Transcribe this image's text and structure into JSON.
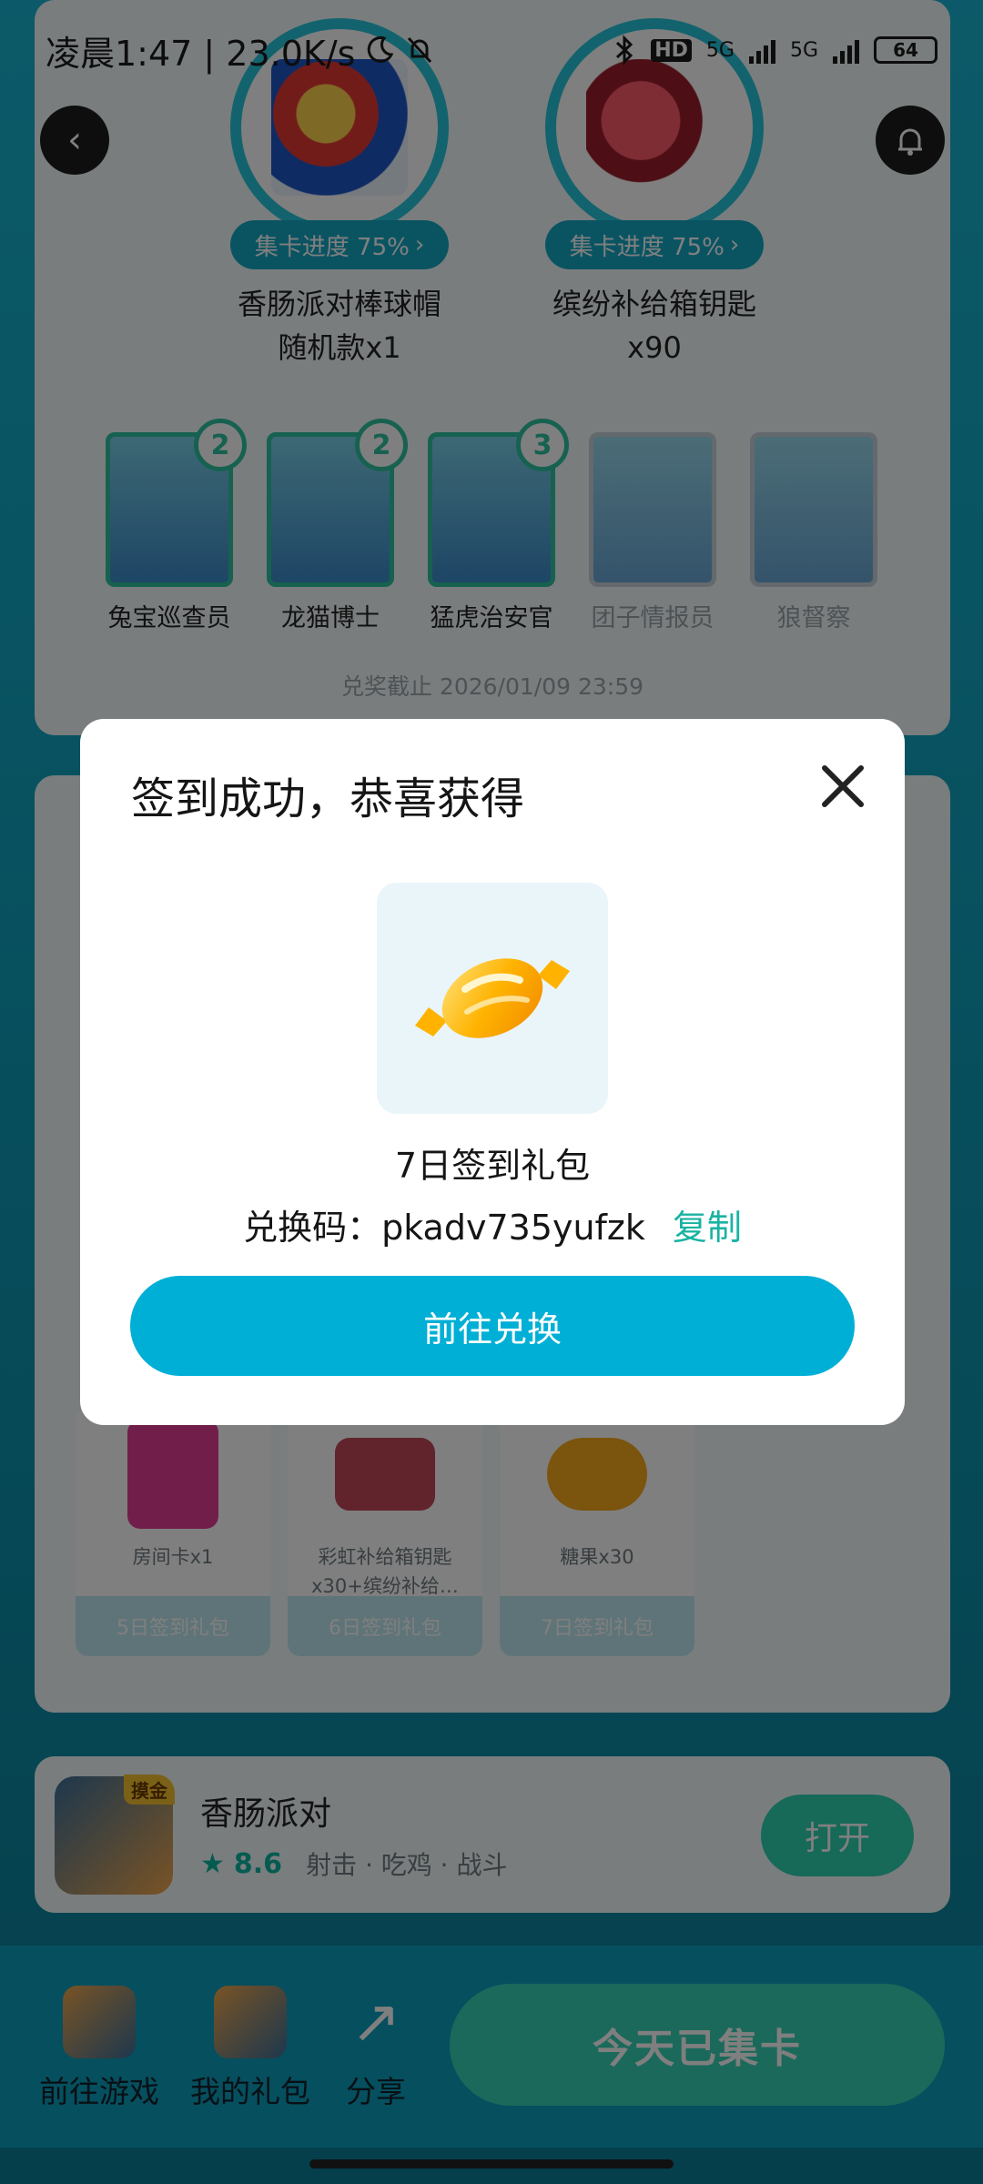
{
  "status_bar": {
    "time_speed": "凌晨1:47 | 23.0K/s",
    "network": "5G",
    "hd": "HD",
    "battery": "64"
  },
  "prizes": [
    {
      "progress": "集卡进度 75%",
      "name_line1": "香肠派对棒球帽",
      "name_line2": "随机款x1"
    },
    {
      "progress": "集卡进度 75%",
      "name_line1": "缤纷补给箱钥匙",
      "name_line2": "x90"
    }
  ],
  "characters": [
    {
      "name": "兔宝巡查员",
      "count": "2"
    },
    {
      "name": "龙猫博士",
      "count": "2"
    },
    {
      "name": "猛虎治安官",
      "count": "3"
    },
    {
      "name": "团子情报员",
      "count": ""
    },
    {
      "name": "狼督察",
      "count": ""
    }
  ],
  "deadline": "兑奖截止 2026/01/09 23:59",
  "gifts": [
    {
      "text_line1": "房间卡x1",
      "text_line2": "",
      "footer": "5日签到礼包"
    },
    {
      "text_line1": "彩虹补给箱钥匙",
      "text_line2": "x30+缤纷补给…",
      "footer": "6日签到礼包"
    },
    {
      "text_line1": "糖果x30",
      "text_line2": "",
      "footer": "7日签到礼包"
    }
  ],
  "app": {
    "title": "香肠派对",
    "tag": "摸金",
    "rating": "8.6",
    "categories": "射击 · 吃鸡 · 战斗",
    "open_label": "打开"
  },
  "bottom_bar": {
    "tab_game": "前往游戏",
    "tab_gifts": "我的礼包",
    "tab_share": "分享",
    "collect_label": "今天已集卡"
  },
  "modal": {
    "title": "签到成功，恭喜获得",
    "reward_name": "7日签到礼包",
    "code_prefix": "兑换码：",
    "code_value": "pkadv735yufzk",
    "copy_label": "复制",
    "redeem_label": "前往兑换"
  },
  "colors": {
    "accent": "#00afd6",
    "copy": "#18b3a2",
    "teal": "#2ed3b0"
  }
}
